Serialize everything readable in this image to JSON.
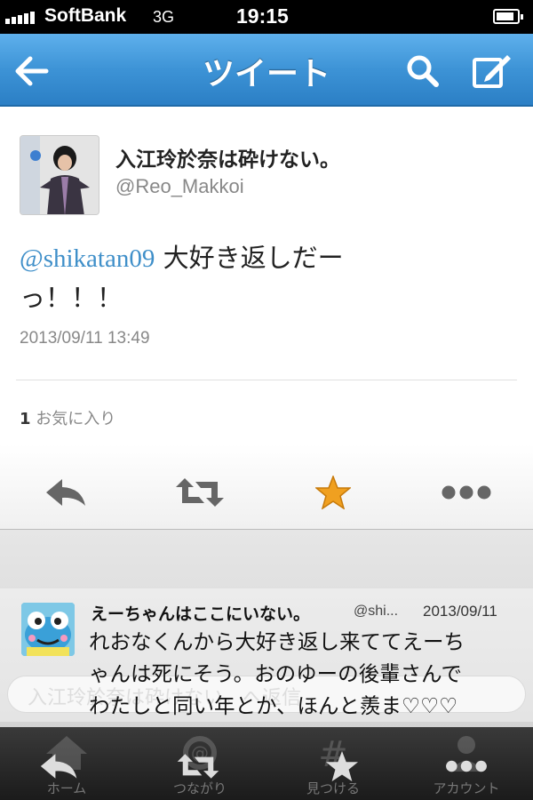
{
  "status_bar": {
    "carrier": "SoftBank",
    "network": "3G",
    "time": "19:15",
    "signal_bars": 5,
    "battery_level": 0.85
  },
  "nav": {
    "title": "ツイート",
    "back_icon": "back-arrow-icon",
    "search_icon": "search-icon",
    "compose_icon": "compose-icon"
  },
  "tweet": {
    "display_name": "入江玲於奈は砕けない。",
    "handle": "@Reo_Makkoi",
    "mention": "@shikatan09",
    "text_line1": " 大好き返しだー",
    "text_line2": "っ！！！",
    "timestamp": "2013/09/11 13:49",
    "favorite_count": "1",
    "favorite_label": " お気に入り",
    "actions": [
      "reply-icon",
      "retweet-icon",
      "favorite-star-icon",
      "more-icon"
    ],
    "accent_color": "#3f8fc9",
    "star_color": "#f0a020"
  },
  "reply_tweet": {
    "display_name": "えーちゃんはここにいない。",
    "handle": "@shi...",
    "date": "2013/09/11",
    "text_line1": "れおなくんから大好き返し来ててえーち",
    "text_line2": "ゃんは死にそう。おのゆーの後輩さんで",
    "text_line3": "わたしと同い年とか、ほんと羨ま♡♡♡"
  },
  "compose": {
    "placeholder": "入江玲於奈は砕けない。へ返信"
  },
  "tabbar": {
    "tabs": [
      {
        "label": "ホーム",
        "icon": "home-icon"
      },
      {
        "label": "つながり",
        "icon": "connect-icon"
      },
      {
        "label": "見つける",
        "icon": "discover-icon"
      },
      {
        "label": "アカウント",
        "icon": "account-icon"
      }
    ]
  }
}
